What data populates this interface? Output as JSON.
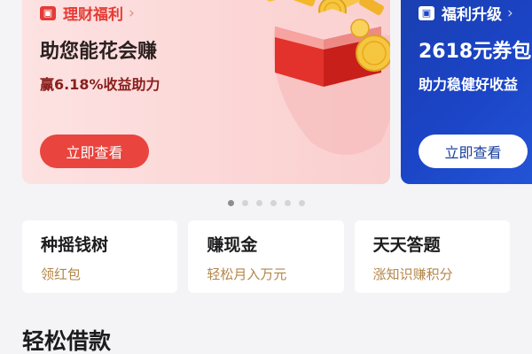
{
  "banners": [
    {
      "tag": "理财福利",
      "title": "助您能花会赚",
      "subtitle": "赢6.18%收益助力",
      "button": "立即查看",
      "accent": "#e9443e"
    },
    {
      "tag": "福利升级",
      "title": "2618元券包",
      "subtitle": "助力稳健好收益",
      "button": "立即查看",
      "accent": "#1b44c6"
    }
  ],
  "carousel": {
    "page_count": 6,
    "active_index": 0
  },
  "features": [
    {
      "title": "种摇钱树",
      "subtitle": "领红包"
    },
    {
      "title": "赚现金",
      "subtitle": "轻松月入万元"
    },
    {
      "title": "天天答题",
      "subtitle": "涨知识赚积分"
    }
  ],
  "section": {
    "title": "轻松借款"
  }
}
